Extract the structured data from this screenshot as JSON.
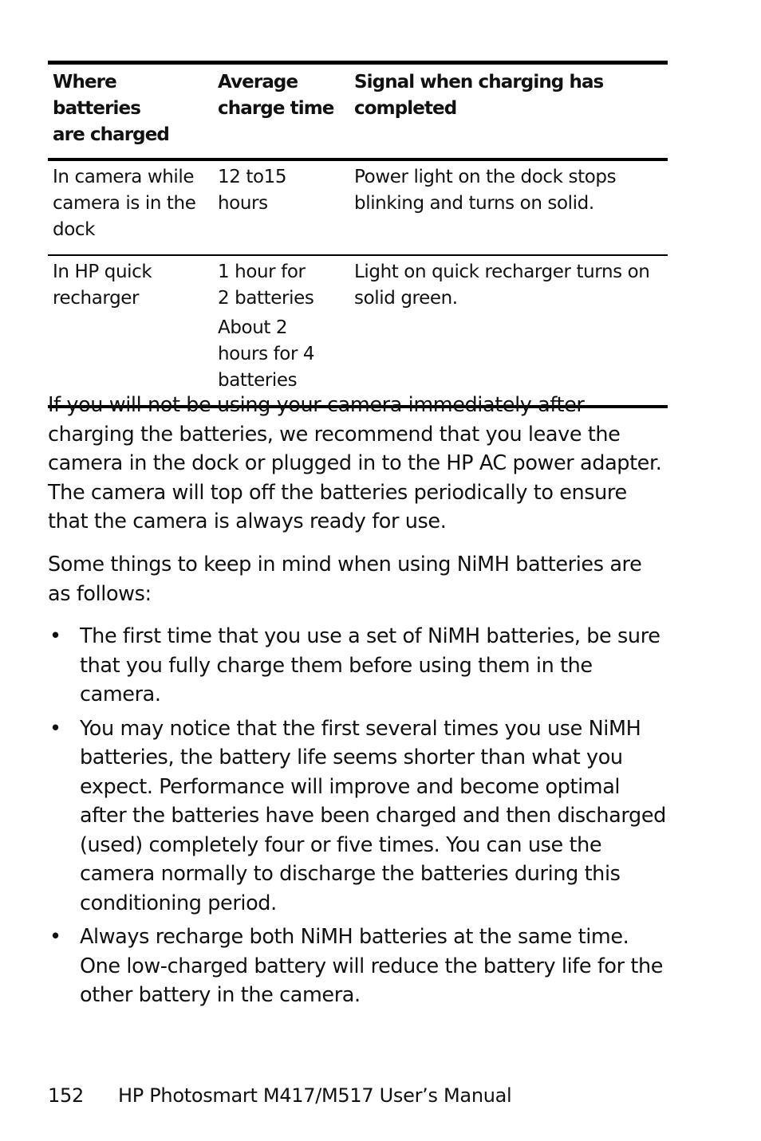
{
  "table": {
    "headers": [
      [
        "Where batteries",
        "are charged"
      ],
      [
        "Average",
        "charge time"
      ],
      [
        "Signal when charging has",
        "completed"
      ]
    ],
    "rows": [
      {
        "location": [
          "In camera while",
          "camera is in the",
          "dock"
        ],
        "time": [
          "12 to15",
          "hours"
        ],
        "time_extra": [],
        "signal": [
          "Power light on the dock stops",
          "blinking and turns on solid."
        ]
      },
      {
        "location": [
          "In HP quick",
          "recharger"
        ],
        "time": [
          "1 hour for",
          "2 batteries"
        ],
        "time_extra": [
          "About 2",
          "hours for 4",
          "batteries"
        ],
        "signal": [
          "Light on quick recharger turns on",
          "solid green."
        ]
      }
    ]
  },
  "paragraphs": [
    "If you will not be using your camera immediately after charging the batteries, we recommend that you leave the camera in the dock or plugged in to the HP AC power adapter. The camera will top off the batteries periodically to ensure that the camera is always ready for use.",
    "Some things to keep in mind when using NiMH batteries are as follows:"
  ],
  "bullets": [
    "The first time that you use a set of NiMH batteries, be sure that you fully charge them before using them in the camera.",
    "You may notice that the first several times you use NiMH batteries, the battery life seems shorter than what you expect. Performance will improve and become optimal after the batteries have been charged and then discharged (used) completely four or five times. You can use the camera normally to discharge the batteries during this conditioning period.",
    "Always recharge both NiMH batteries at the same time. One low-charged battery will reduce the battery life for the other battery in the camera."
  ],
  "bullet_symbol": "•",
  "footer": {
    "page_number": "152",
    "title": "HP Photosmart M417/M517 User’s Manual"
  }
}
